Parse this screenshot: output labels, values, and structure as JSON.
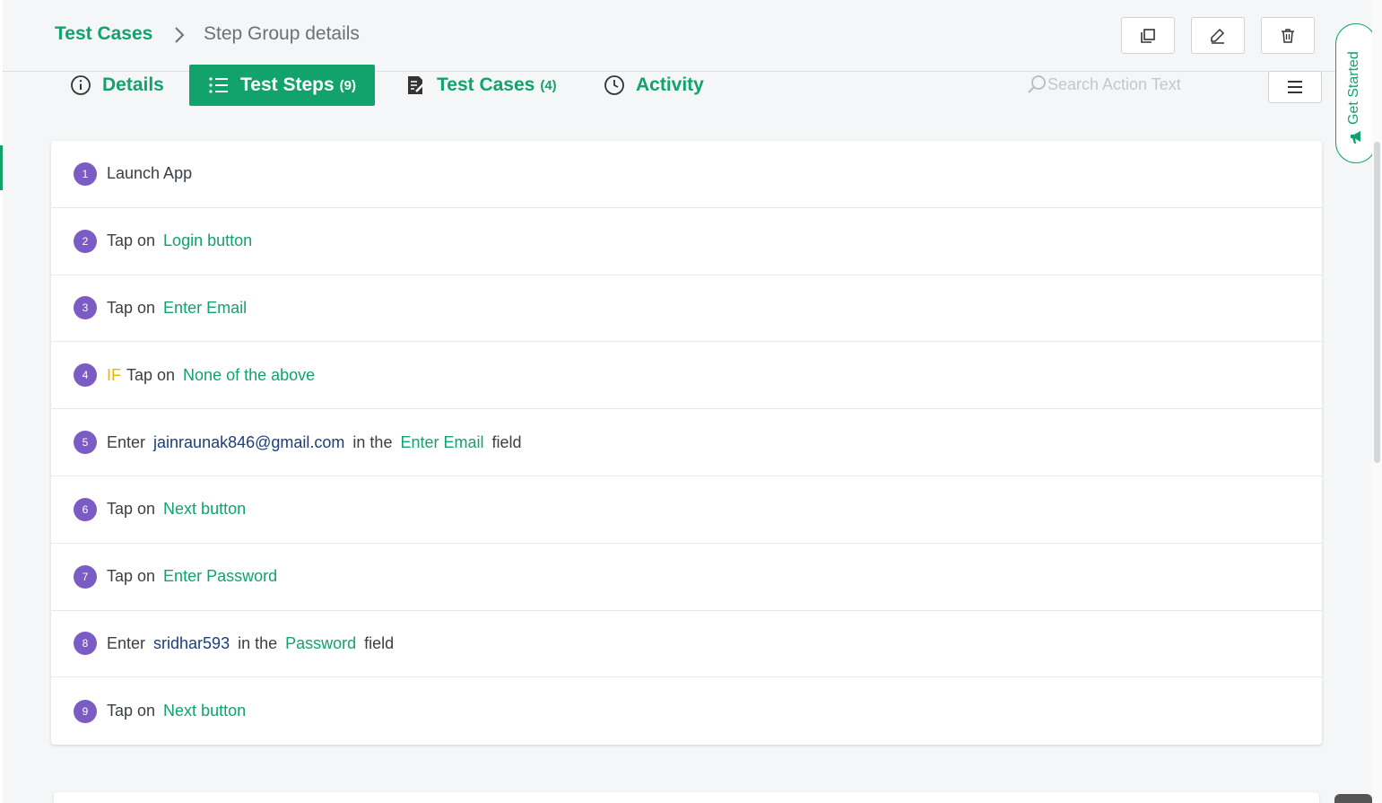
{
  "breadcrumb": {
    "root": "Test Cases",
    "current": "Step Group details"
  },
  "header_actions": {
    "copy_icon": "copy-icon",
    "edit_icon": "pencil-icon",
    "delete_icon": "trash-icon"
  },
  "tabs": [
    {
      "label": "Details",
      "count": "",
      "icon": "info-icon",
      "active": false
    },
    {
      "label": "Test Steps",
      "count": "(9)",
      "icon": "list-icon",
      "active": true
    },
    {
      "label": "Test Cases",
      "count": "(4)",
      "icon": "testcase-icon",
      "active": false
    },
    {
      "label": "Activity",
      "count": "",
      "icon": "clock-icon",
      "active": false
    }
  ],
  "search": {
    "placeholder": "Search Action Text",
    "value": ""
  },
  "get_started": {
    "label": "Get Started",
    "icon": "megaphone-icon"
  },
  "colors": {
    "accent": "#11a36b",
    "step_number": "#7a5cc4",
    "data_value": "#1a3f7a",
    "condition": "#e8b800"
  },
  "steps": [
    {
      "num": "1",
      "parts": [
        {
          "type": "plain",
          "text": "Launch App"
        }
      ]
    },
    {
      "num": "2",
      "parts": [
        {
          "type": "plain",
          "text": "Tap on"
        },
        {
          "type": "element",
          "text": "Login button"
        }
      ]
    },
    {
      "num": "3",
      "parts": [
        {
          "type": "plain",
          "text": "Tap on"
        },
        {
          "type": "element",
          "text": "Enter Email"
        }
      ]
    },
    {
      "num": "4",
      "parts": [
        {
          "type": "condition",
          "text": "IF"
        },
        {
          "type": "plain",
          "text": "Tap on"
        },
        {
          "type": "element",
          "text": "None of the above"
        }
      ]
    },
    {
      "num": "5",
      "parts": [
        {
          "type": "plain",
          "text": "Enter"
        },
        {
          "type": "data",
          "text": "jainraunak846@gmail.com"
        },
        {
          "type": "plain",
          "text": "in the"
        },
        {
          "type": "element",
          "text": "Enter Email"
        },
        {
          "type": "plain",
          "text": "field"
        }
      ]
    },
    {
      "num": "6",
      "parts": [
        {
          "type": "plain",
          "text": "Tap on"
        },
        {
          "type": "element",
          "text": "Next button"
        }
      ]
    },
    {
      "num": "7",
      "parts": [
        {
          "type": "plain",
          "text": "Tap on"
        },
        {
          "type": "element",
          "text": "Enter Password"
        }
      ]
    },
    {
      "num": "8",
      "parts": [
        {
          "type": "plain",
          "text": "Enter"
        },
        {
          "type": "data",
          "text": "sridhar593"
        },
        {
          "type": "plain",
          "text": "in the"
        },
        {
          "type": "element",
          "text": "Password"
        },
        {
          "type": "plain",
          "text": "field"
        }
      ]
    },
    {
      "num": "9",
      "parts": [
        {
          "type": "plain",
          "text": "Tap on"
        },
        {
          "type": "element",
          "text": "Next button"
        }
      ]
    }
  ]
}
